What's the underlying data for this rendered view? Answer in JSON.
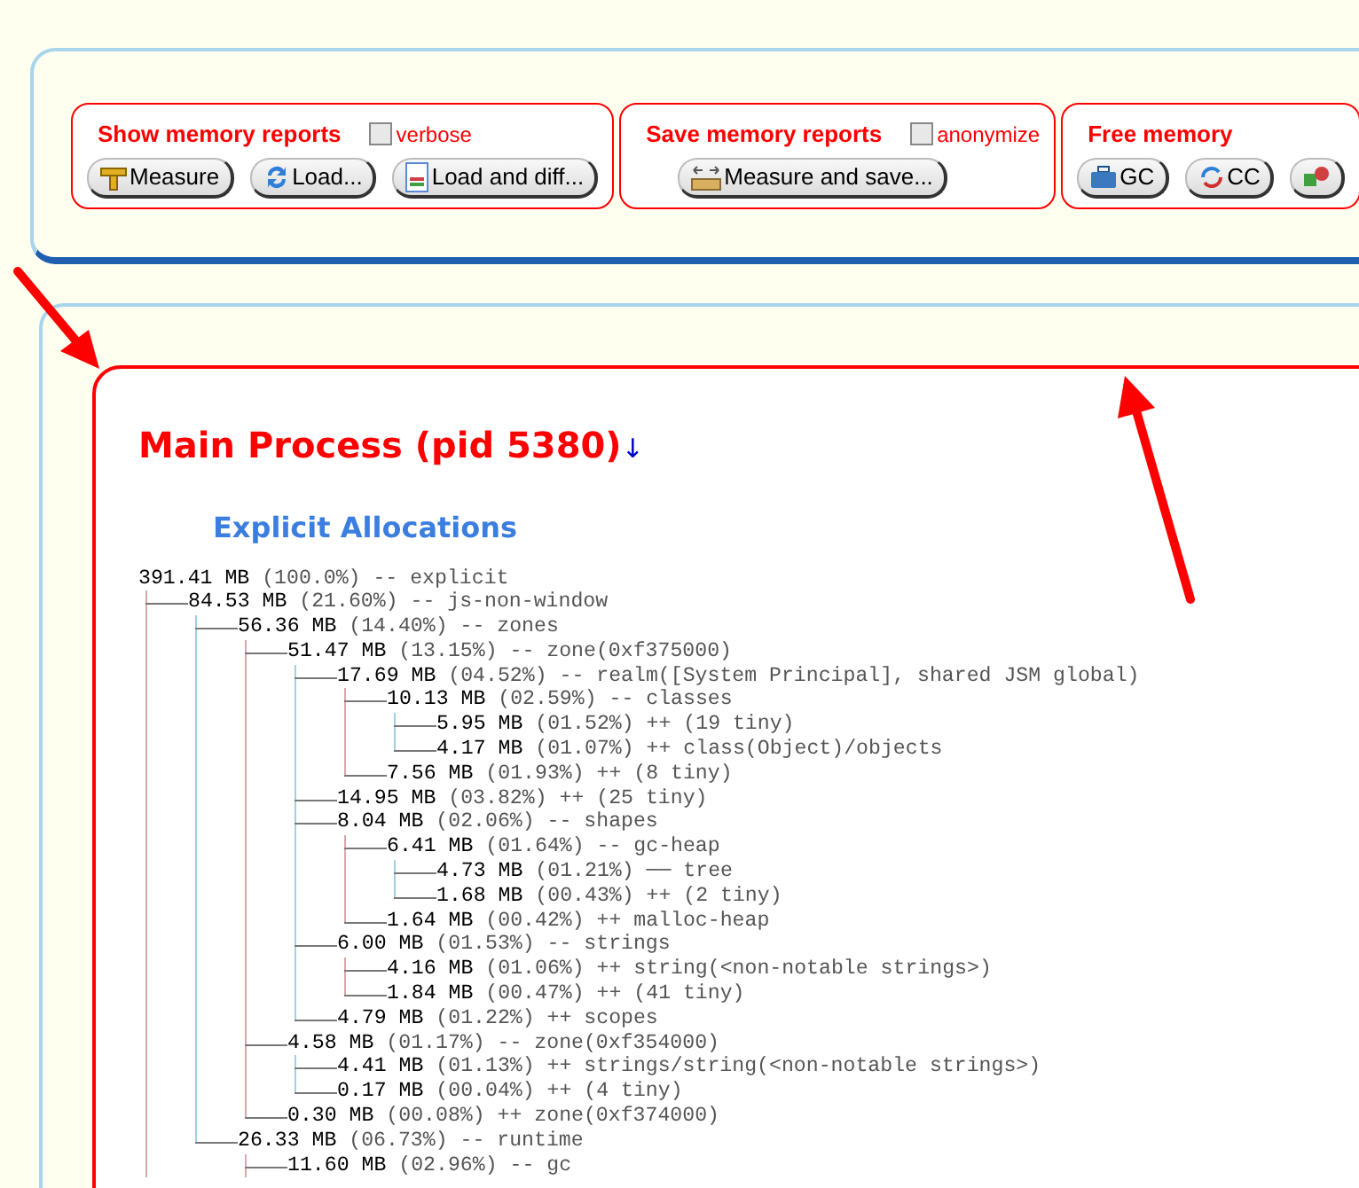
{
  "toolbar": {
    "sections": [
      {
        "title": "Show memory reports",
        "option": {
          "label": "verbose",
          "checked": false
        },
        "buttons": [
          {
            "kind": "ruler",
            "label": "Measure"
          },
          {
            "kind": "refresh",
            "label": "Load..."
          },
          {
            "kind": "document",
            "label": "Load and diff..."
          }
        ]
      },
      {
        "title": "Save memory reports",
        "option": {
          "label": "anonymize",
          "checked": false
        },
        "buttons": [
          {
            "kind": "ruler-arrows",
            "label": "Measure and save..."
          }
        ]
      },
      {
        "title": "Free memory",
        "buttons": [
          {
            "kind": "briefcase",
            "label": "GC"
          },
          {
            "kind": "cycle",
            "label": "CC"
          },
          {
            "kind": "shapes"
          }
        ]
      }
    ]
  },
  "process": {
    "title": "Main Process (pid 5380)",
    "link": "↓",
    "section_title": "Explicit Allocations",
    "tree": {
      "text": "**391.41 MB** (100.0%) -- explicit",
      "children": [
        {
          "text": "**84.53 MB** (21.60%) -- js-non-window",
          "continues": true,
          "children": [
            {
              "text": "**56.36 MB** (14.40%) -- zones",
              "children": [
                {
                  "text": "**51.47 MB** (13.15%) -- zone(0xf375000)",
                  "children": [
                    {
                      "text": "**17.69 MB** (04.52%) -- realm([System Principal], shared JSM global)",
                      "children": [
                        {
                          "text": "**10.13 MB** (02.59%) -- classes",
                          "children": [
                            {
                              "text": "**5.95 MB** (01.52%) ++ (19 tiny)"
                            },
                            {
                              "text": "**4.17 MB** (01.07%) ++ class(Object)/objects"
                            }
                          ]
                        },
                        {
                          "text": "**7.56 MB** (01.93%) ++ (8 tiny)"
                        }
                      ]
                    },
                    {
                      "text": "**14.95 MB** (03.82%) ++ (25 tiny)"
                    },
                    {
                      "text": "**8.04 MB** (02.06%) -- shapes",
                      "children": [
                        {
                          "text": "**6.41 MB** (01.64%) -- gc-heap",
                          "children": [
                            {
                              "text": "**4.73 MB** (01.21%) ── tree"
                            },
                            {
                              "text": "**1.68 MB** (00.43%) ++ (2 tiny)"
                            }
                          ]
                        },
                        {
                          "text": "**1.64 MB** (00.42%) ++ malloc-heap"
                        }
                      ]
                    },
                    {
                      "text": "**6.00 MB** (01.53%) -- strings",
                      "children": [
                        {
                          "text": "**4.16 MB** (01.06%) ++ string(<non-notable strings>)"
                        },
                        {
                          "text": "**1.84 MB** (00.47%) ++ (41 tiny)"
                        }
                      ]
                    },
                    {
                      "text": "**4.79 MB** (01.22%) ++ scopes"
                    }
                  ]
                },
                {
                  "text": "**4.58 MB** (01.17%) -- zone(0xf354000)",
                  "children": [
                    {
                      "text": "**4.41 MB** (01.13%) ++ strings/string(<non-notable strings>)"
                    },
                    {
                      "text": "**0.17 MB** (00.04%) ++ (4 tiny)"
                    }
                  ]
                },
                {
                  "text": "**0.30 MB** (00.08%) ++ zone(0xf374000)"
                }
              ]
            },
            {
              "text": "**26.33 MB** (06.73%) -- runtime",
              "children": [
                {
                  "text": "**11.60 MB** (02.96%) -- gc",
                  "continues": true
                }
              ]
            }
          ]
        }
      ]
    }
  }
}
